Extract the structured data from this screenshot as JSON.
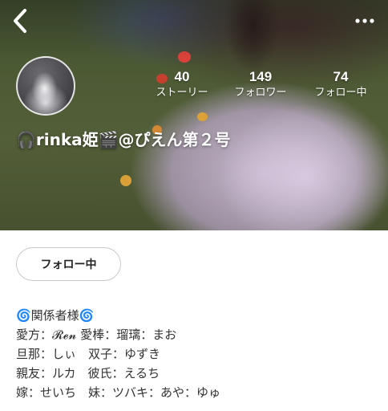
{
  "header": {
    "back_icon": "chevron-left-icon",
    "more_icon": "more-horizontal-icon"
  },
  "profile": {
    "display_name": "🎧rinka姫🎬@ぴえん第２号",
    "avatar": "avatar"
  },
  "stats": [
    {
      "value": "40",
      "label": "ストーリー"
    },
    {
      "value": "149",
      "label": "フォロワー"
    },
    {
      "value": "74",
      "label": "フォロー中"
    }
  ],
  "actions": {
    "follow_label": "フォロー中"
  },
  "bio": {
    "lines": [
      "🌀関係者様🌀",
      "愛方：𝓡𝓮𝓷 愛棒：瑠璃：まお",
      "旦那：しぃ　双子：ゆずき",
      "親友：ルカ　彼氏：えるち",
      "嫁：せいち　妹：ツバキ：あや：ゆゅ"
    ]
  },
  "colors": {
    "text_dark": "#333333",
    "button_border": "#c9c9c9",
    "overlay_text": "#ffffff"
  }
}
